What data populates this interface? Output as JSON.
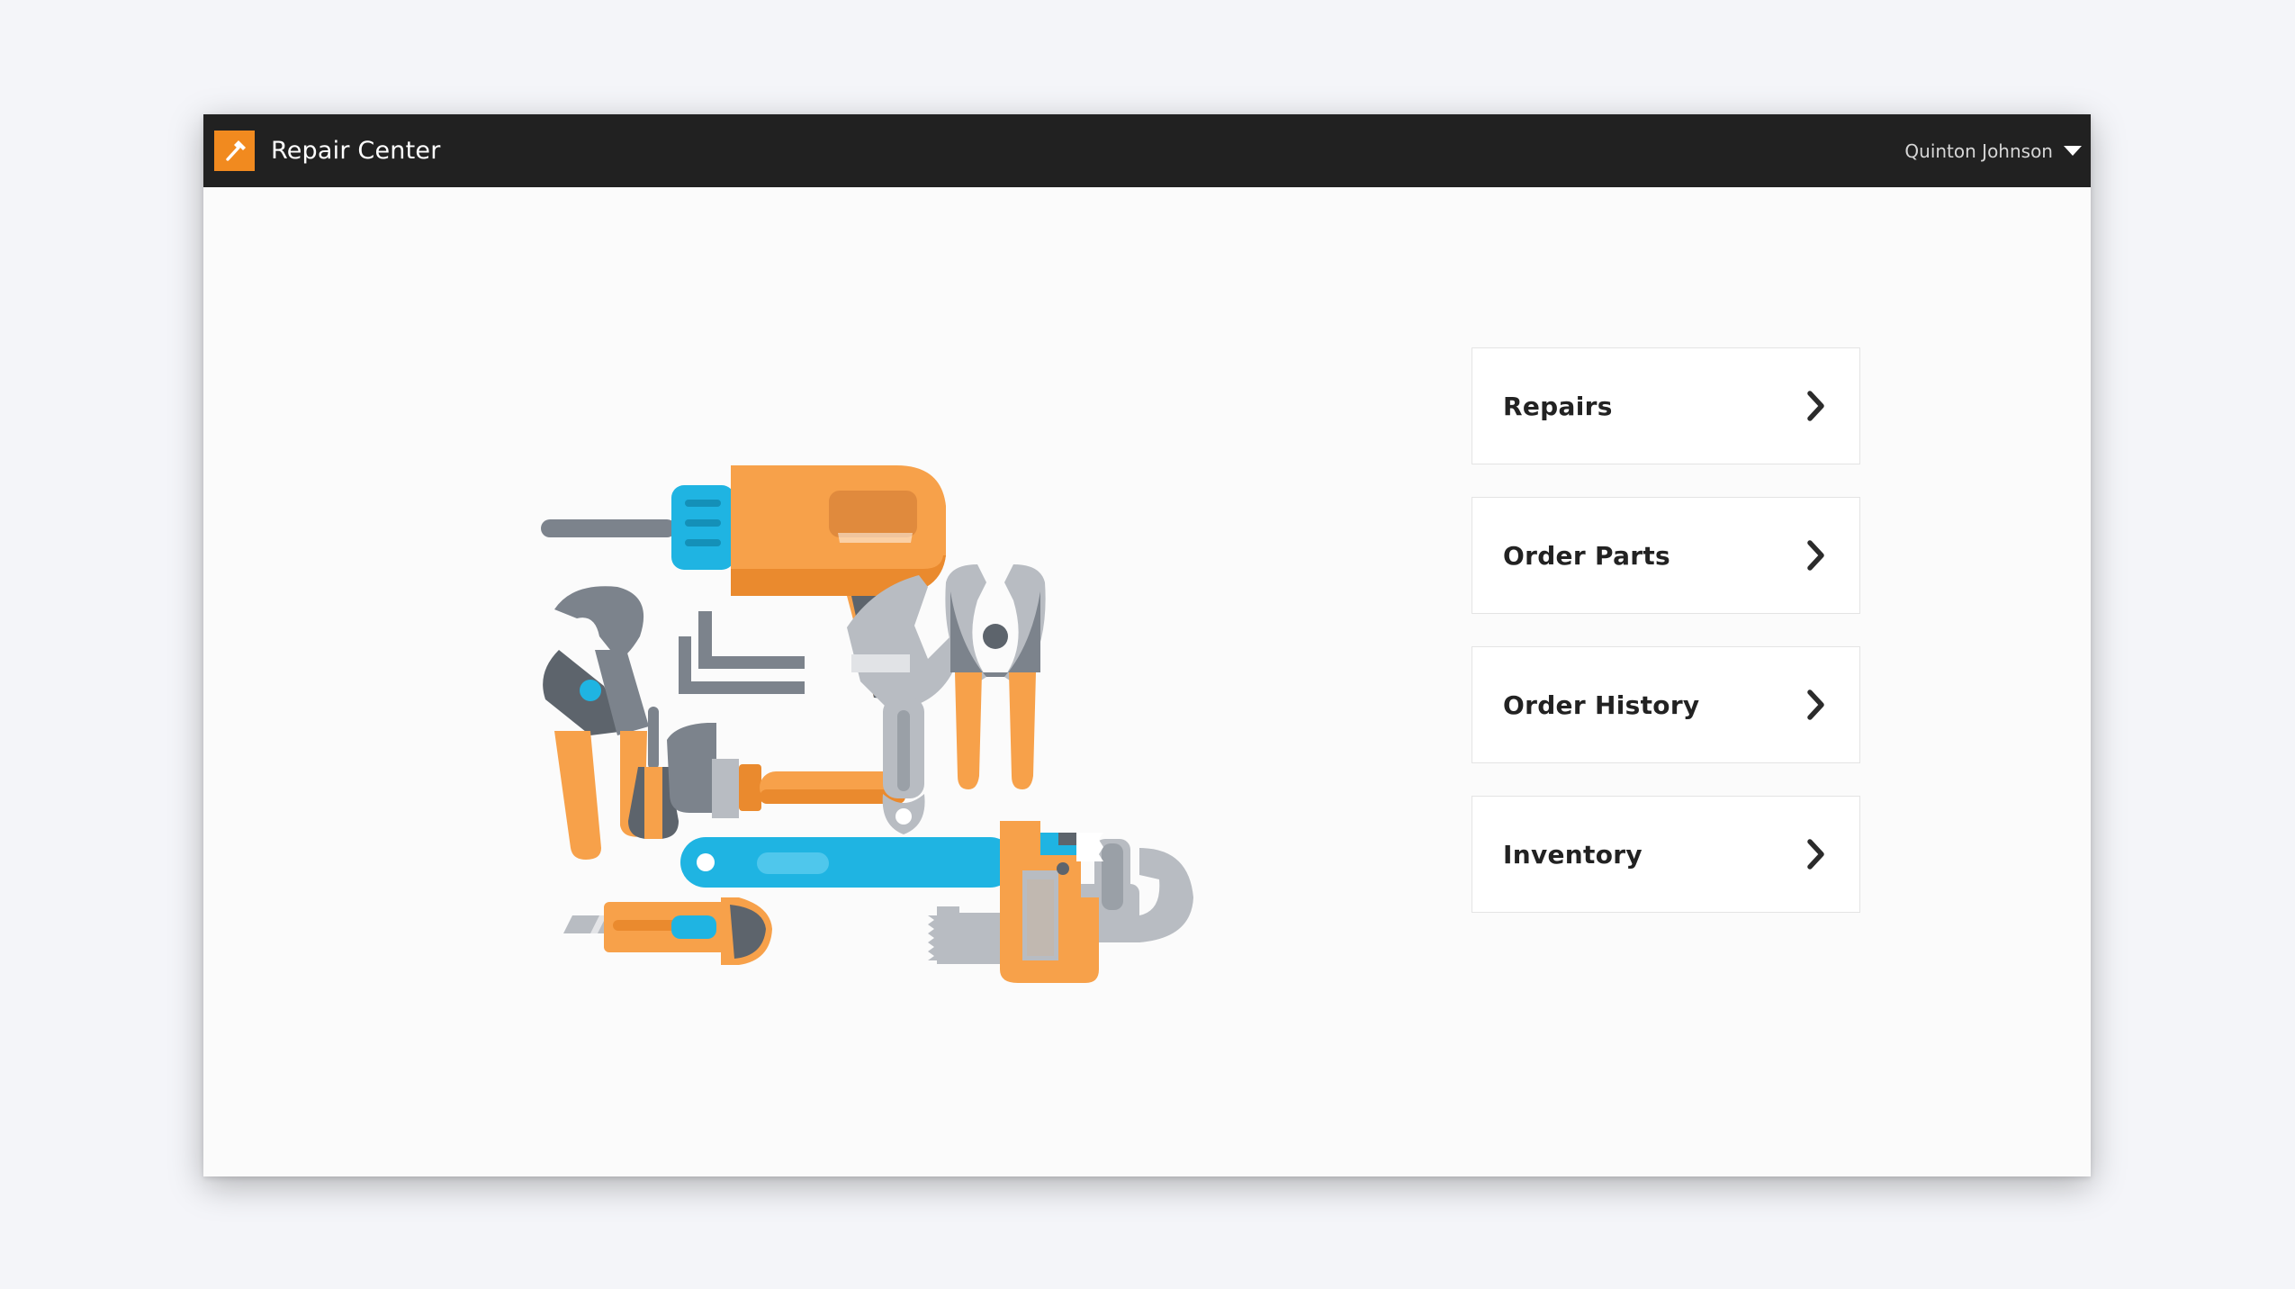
{
  "header": {
    "app_title": "Repair Center",
    "logo_icon": "hammer-icon",
    "user_name": "Quinton Johnson",
    "user_menu_icon": "caret-down-icon"
  },
  "menu": {
    "items": [
      {
        "label": "Repairs",
        "icon": "chevron-right-icon"
      },
      {
        "label": "Order Parts",
        "icon": "chevron-right-icon"
      },
      {
        "label": "Order History",
        "icon": "chevron-right-icon"
      },
      {
        "label": "Inventory",
        "icon": "chevron-right-icon"
      }
    ]
  },
  "illustration": {
    "name": "tools-illustration",
    "colors": {
      "orange": "#f7a14a",
      "orange_dark": "#ea8a2e",
      "gray": "#7c838c",
      "gray_light": "#b8bcc2",
      "gray_dark": "#5d646c",
      "blue": "#1fb4e2"
    }
  }
}
